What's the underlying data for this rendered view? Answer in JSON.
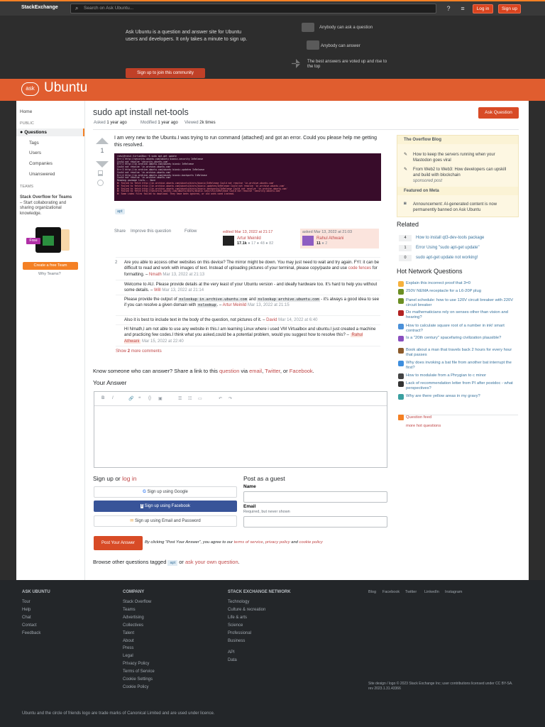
{
  "topbar": {
    "logo_brand": "Stack",
    "logo_rest": "Exchange",
    "search_placeholder": "Search on Ask Ubuntu...",
    "help_icon": "?",
    "inbox_icon": "≡",
    "login": "Log in",
    "signup": "Sign up"
  },
  "hero": {
    "text": "Ask Ubuntu is a question and answer site for Ubuntu users and developers. It only takes a minute to sign up.",
    "join": "Sign up to join this community",
    "items": [
      "Anybody can ask a question",
      "Anybody can answer",
      "The best answers are voted up and rise to the top"
    ]
  },
  "site": {
    "bubble": "ask",
    "name": "Ubuntu"
  },
  "leftnav": {
    "home": "Home",
    "public": "PUBLIC",
    "questions": "Questions",
    "tags": "Tags",
    "users": "Users",
    "companies": "Companies",
    "unanswered": "Unanswered",
    "teams": "TEAMS",
    "teams_title": "Stack Overflow for Teams",
    "teams_desc": " – Start collaborating and sharing organizational knowledge.",
    "free": "Free",
    "create_team": "Create a free Team",
    "why_teams": "Why Teams?"
  },
  "question": {
    "title": "sudo apt install net-tools",
    "ask_button": "Ask Question",
    "asked_label": "Asked",
    "asked_value": "1 year ago",
    "modified_label": "Modified",
    "modified_value": "1 year ago",
    "viewed_label": "Viewed",
    "viewed_value": "2k times",
    "score": "1",
    "body": "I am very new to the Ubuntu.I was trying to run command (attached) and got an error. Could you please help me getting this resolved.",
    "terminal_lines": [
      {
        "t": "rahul@rahul-VirtualBox:~$ sudo apt-get update",
        "e": false
      },
      {
        "t": "Err:1 http://security.ubuntu.com/ubuntu bionic-security InRelease",
        "e": false
      },
      {
        "t": "  Could not resolve 'security.ubuntu.com'",
        "e": false
      },
      {
        "t": "Err:2 http://in.archive.ubuntu.com/ubuntu bionic InRelease",
        "e": false
      },
      {
        "t": "  Could not resolve 'in.archive.ubuntu.com'",
        "e": false
      },
      {
        "t": "Err:3 http://in.archive.ubuntu.com/ubuntu bionic-updates InRelease",
        "e": false
      },
      {
        "t": "  Could not resolve 'in.archive.ubuntu.com'",
        "e": false
      },
      {
        "t": "Err:4 http://in.archive.ubuntu.com/ubuntu bionic-backports InRelease",
        "e": false
      },
      {
        "t": "  Could not resolve 'in.archive.ubuntu.com'",
        "e": false
      },
      {
        "t": "Reading package lists... Done",
        "e": false
      },
      {
        "t": "W: Failed to fetch http://in.archive.ubuntu.com/ubuntu/dists/bionic/InRelease  Could not resolve 'in.archive.ubuntu.com'",
        "e": true
      },
      {
        "t": "W: Failed to fetch http://in.archive.ubuntu.com/ubuntu/dists/bionic-updates/InRelease  Could not resolve 'in.archive.ubuntu.com'",
        "e": true
      },
      {
        "t": "W: Failed to fetch http://in.archive.ubuntu.com/ubuntu/dists/bionic-backports/InRelease  Could not resolve 'in.archive.ubuntu.com'",
        "e": true
      },
      {
        "t": "W: Failed to fetch http://security.ubuntu.com/ubuntu/dists/bionic-security/InRelease  Could not resolve 'security.ubuntu.com'",
        "e": true
      },
      {
        "t": "W: Some index files failed to download. They have been ignored, or old ones used instead.",
        "e": true
      }
    ],
    "tag": "apt",
    "share": "Share",
    "improve": "Improve this question",
    "follow": "Follow",
    "edited_label": "edited Mar 13, 2022 at 21:17",
    "editor_name": "Artur Meinild",
    "editor_rep": "17.1k",
    "editor_badges": "● 17  ● 48  ● 82",
    "asked_card_label": "asked Mar 13, 2022 at 21:03",
    "asker_name": "Rahul Athwani",
    "asker_rep": "11",
    "asker_badges": "● 2"
  },
  "comments": {
    "count_badge": "2",
    "c1_text": "Are you able to access other websites on this device? The mirror might be down. You may just need to wait and try again. FYI: it can be difficult to read and work with images of text. Instead of uploading pictures of your terminal, please copy/paste and use ",
    "c1_link": "code fences",
    "c1_after": " for formatting. – ",
    "c1_user": "Nmath",
    "c1_date": " Mar 13, 2022 at 21:13",
    "c2_text": "Welcome to AU. Please provide details at the very least of your Ubuntu version - and ideally hardware too. It's hard to help you without some details. – ",
    "c2_user": "Will",
    "c2_date": " Mar 13, 2022 at 21:14",
    "c3_a": "Please provide the output of ",
    "c3_code1": "nslookup in.archive.ubuntu.com",
    "c3_b": " and ",
    "c3_code2": "nslookup archive.ubuntu.com",
    "c3_c": " - it's always a good idea to see if you can resolve a given domain with ",
    "c3_code3": "nslookup",
    "c3_d": ". – ",
    "c3_user": "Artur Meinild",
    "c3_date": " Mar 13, 2022 at 21:15",
    "c4_text": "Also it is best to include text in the body of the question, not pictures of it. – ",
    "c4_user": "David",
    "c4_date": " Mar 14, 2022 at 6:40",
    "c5_text": "HI Nmath,I am not able to use any website in this.I am learning Linux where i used VM Virtualbox and ubuntu.I just created a machine and practicing few codes.I think what you asked,could be a potential problem, would you suggest how to resolve this? – ",
    "c5_user": "Rahul Athwani",
    "c5_date": " Mar 15, 2022 at 22:40",
    "show_more_a": "Show ",
    "show_more_b": "2",
    "show_more_c": " more comments"
  },
  "blog": {
    "h1": "The Overflow Blog",
    "i1": "How to keep the servers running when your Mastodon goes viral",
    "i2": "From Web2 to Web3: How developers can upskill and build with blockchain",
    "sponsored": "sponsored post",
    "h2": "Featured on Meta",
    "i3": "Announcement: AI-generated content is now permanently banned on Ask Ubuntu"
  },
  "related": {
    "title": "Related",
    "items": [
      {
        "count": "4",
        "text": "How to install qt3-dev-tools package"
      },
      {
        "count": "1",
        "text": "Error Using \"sudo apt-get update\""
      },
      {
        "count": "0",
        "text": "sudo apt-get update not working!"
      }
    ]
  },
  "hnq": {
    "title": "Hot Network Questions",
    "items": [
      {
        "text": "Explain this incorrect proof that 3=0",
        "color": "#f6b13d"
      },
      {
        "text": "250V NEMA receptacle for a L6-20P plug",
        "color": "#6b8e23"
      },
      {
        "text": "Panel schedule: how to use 120V circuit breaker with 220V circuit breaker",
        "color": "#6b8e23"
      },
      {
        "text": "Do mathematicians rely on senses other than vision and hearing?",
        "color": "#b22222"
      },
      {
        "text": "How to calculate square root of a number in ink! smart contract?",
        "color": "#4a90d9"
      },
      {
        "text": "Is a \"20th century\" spacefaring civilization plausible?",
        "color": "#8a4fbf"
      },
      {
        "text": "Book about a man that travels back 2 hours for every hour that passes",
        "color": "#8b5a2b"
      },
      {
        "text": "Why does invoking a bat file from another bat interrupt the first?",
        "color": "#3e8ede"
      },
      {
        "text": "How to modulate from a Phrygian to c minor",
        "color": "#444444"
      },
      {
        "text": "Lack of recommendation letter from PI after postdoc - what perspectives?",
        "color": "#333333"
      },
      {
        "text": "Why are there yellow areas in my gravy?",
        "color": "#3aa0a0"
      }
    ],
    "more": "more hot questions",
    "feed": "Question feed"
  },
  "answer": {
    "share_a": "Know someone who can answer? Share a link to this ",
    "share_q": "question",
    "share_via": " via ",
    "share_email": "email",
    "share_twitter": "Twitter",
    "share_or": ", or ",
    "share_fb": "Facebook",
    "your_answer": "Your Answer",
    "toolbar": [
      "B",
      "I",
      "🔗",
      "❝",
      "{}",
      "▣",
      "☰",
      "☷",
      "▭",
      "↶",
      "↷"
    ]
  },
  "signup": {
    "title_a": "Sign up",
    "title_b": " or ",
    "title_c": "log in",
    "google": "Sign up using Google",
    "facebook": "Sign up using Facebook",
    "email": "Sign up using Email and Password",
    "guest": "Post as a guest",
    "name_label": "Name",
    "email_label": "Email",
    "email_note": "Required, but never shown",
    "post": "Post Your Answer",
    "agree_a": "By clicking “Post Your Answer”, you agree to our ",
    "terms": "terms of service",
    "privacy": "privacy policy",
    "and": " and ",
    "cookie": "cookie policy",
    "browse_a": "Browse other questions tagged ",
    "browse_tag": "apt",
    "browse_or": " or ",
    "browse_link": "ask your own question",
    "browse_end": "."
  },
  "footer": {
    "ask": "ASK UBUNTU",
    "ask_links": [
      "Tour",
      "Help",
      "Chat",
      "Contact",
      "Feedback"
    ],
    "company": "COMPANY",
    "company_links": [
      "Stack Overflow",
      "Teams",
      "Advertising",
      "Collectives",
      "Talent",
      "About",
      "Press",
      "Legal",
      "Privacy Policy",
      "Terms of Service",
      "Cookie Settings",
      "Cookie Policy"
    ],
    "network": "STACK EXCHANGE NETWORK",
    "network_links": [
      "Technology",
      "Culture & recreation",
      "Life & arts",
      "Science",
      "Professional",
      "Business"
    ],
    "network_links2": [
      "API",
      "Data"
    ],
    "social": [
      "Blog",
      "Facebook",
      "Twitter",
      "LinkedIn",
      "Instagram"
    ],
    "license": "Site design / logo © 2023 Stack Exchange Inc; user contributions licensed under CC BY-SA. rev 2023.1.31.43366",
    "trademark": "Ubuntu and the circle of friends logo are trade marks of Canonical Limited and are used under licence."
  }
}
